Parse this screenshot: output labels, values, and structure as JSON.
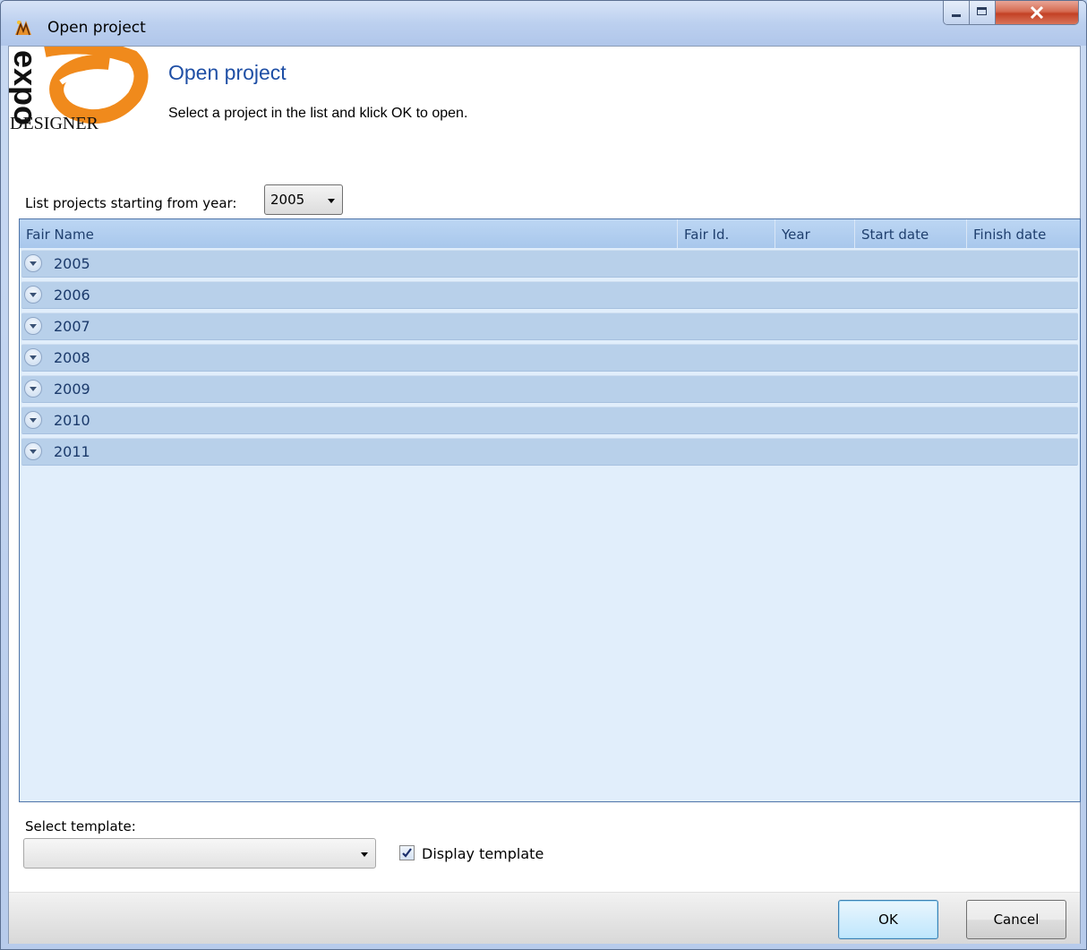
{
  "window": {
    "title": "Open project"
  },
  "header": {
    "title": "Open project",
    "subtitle": "Select a project in the list and klick OK to open.",
    "logo": {
      "word": "expo",
      "sub": "DESIGNER"
    }
  },
  "filter": {
    "label": "List projects starting from year:",
    "selected_year": "2005"
  },
  "grid": {
    "columns": [
      "Fair Name",
      "Fair Id.",
      "Year",
      "Start date",
      "Finish date"
    ],
    "groups": [
      "2005",
      "2006",
      "2007",
      "2008",
      "2009",
      "2010",
      "2011"
    ]
  },
  "template": {
    "label": "Select template:",
    "selected": "",
    "display_label": "Display template",
    "display_checked": true
  },
  "buttons": {
    "ok": "OK",
    "cancel": "Cancel"
  },
  "colors": {
    "header_title": "#1f4fa5",
    "group_row": "#b8d0ea",
    "logo_orange": "#f08a1c"
  }
}
